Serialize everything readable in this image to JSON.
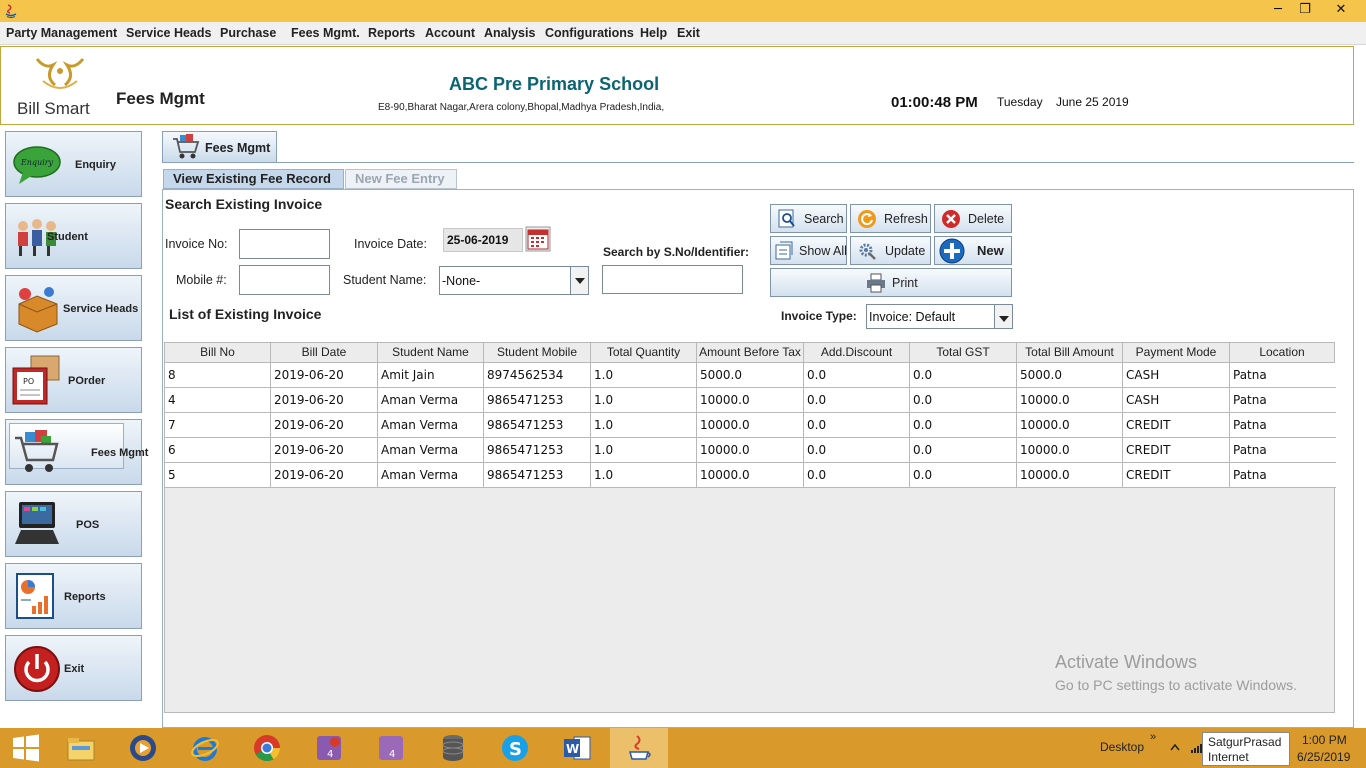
{
  "window": {
    "minimize": "─",
    "maximize": "❐",
    "close": "✕"
  },
  "menu": [
    "Party Management",
    "Service Heads",
    "Purchase",
    "Fees Mgmt.",
    "Reports",
    "Account",
    "Analysis",
    "Configurations",
    "Help",
    "Exit"
  ],
  "header": {
    "logo_text": "Bill Smart",
    "module_title": "Fees Mgmt",
    "school_name": "ABC Pre Primary School",
    "school_address": "E8-90,Bharat Nagar,Arera colony,Bhopal,Madhya Pradesh,India,",
    "time": "01:00:48 PM",
    "day": "Tuesday",
    "date": "June 25 2019"
  },
  "sidebar": {
    "items": [
      {
        "label": "Enquiry",
        "icon": "enquiry-bubble-icon"
      },
      {
        "label": "Student",
        "icon": "students-group-icon"
      },
      {
        "label": "Service Heads",
        "icon": "service-box-icon"
      },
      {
        "label": "POrder",
        "icon": "purchase-order-icon"
      },
      {
        "label": "Fees Mgmt",
        "icon": "shopping-cart-icon",
        "active": true
      },
      {
        "label": "POS",
        "icon": "pos-terminal-icon"
      },
      {
        "label": "Reports",
        "icon": "report-chart-icon"
      },
      {
        "label": "Exit",
        "icon": "power-icon"
      }
    ]
  },
  "main_tab": {
    "label": "Fees Mgmt"
  },
  "subtabs": {
    "active": "View Existing Fee Record",
    "inactive": "New Fee Entry"
  },
  "search": {
    "title": "Search Existing Invoice",
    "invoice_no_label": "Invoice No:",
    "invoice_no_value": "",
    "invoice_date_label": "Invoice Date:",
    "invoice_date_value": "25-06-2019",
    "mobile_label": "Mobile #:",
    "mobile_value": "",
    "student_name_label": "Student Name:",
    "student_name_value": "-None-",
    "sno_label": "Search by S.No/Identifier:",
    "sno_value": ""
  },
  "buttons": {
    "search": "Search",
    "refresh": "Refresh",
    "delete": "Delete",
    "show_all": "Show All",
    "update": "Update",
    "new": "New",
    "print": "Print"
  },
  "list": {
    "title": "List of Existing Invoice",
    "invoice_type_label": "Invoice Type:",
    "invoice_type_value": "Invoice: Default"
  },
  "table": {
    "columns": [
      "Bill No",
      "Bill Date",
      "Student Name",
      "Student Mobile",
      "Total Quantity",
      "Amount Before Tax",
      "Add.Discount",
      "Total GST",
      "Total Bill Amount",
      "Payment Mode",
      "Location"
    ],
    "rows": [
      [
        "8",
        "2019-06-20",
        "Amit Jain",
        "8974562534",
        "1.0",
        "5000.0",
        "0.0",
        "0.0",
        "5000.0",
        "CASH",
        "Patna"
      ],
      [
        "4",
        "2019-06-20",
        "Aman Verma",
        "9865471253",
        "1.0",
        "10000.0",
        "0.0",
        "0.0",
        "10000.0",
        "CASH",
        "Patna"
      ],
      [
        "7",
        "2019-06-20",
        "Aman Verma",
        "9865471253",
        "1.0",
        "10000.0",
        "0.0",
        "0.0",
        "10000.0",
        "CREDIT",
        "Patna"
      ],
      [
        "6",
        "2019-06-20",
        "Aman Verma",
        "9865471253",
        "1.0",
        "10000.0",
        "0.0",
        "0.0",
        "10000.0",
        "CREDIT",
        "Patna"
      ],
      [
        "5",
        "2019-06-20",
        "Aman Verma",
        "9865471253",
        "1.0",
        "10000.0",
        "0.0",
        "0.0",
        "10000.0",
        "CREDIT",
        "Patna"
      ]
    ]
  },
  "watermark": {
    "line1": "Activate Windows",
    "line2": "Go to PC settings to activate Windows."
  },
  "taskbar": {
    "apps": [
      "start-icon",
      "file-explorer-icon",
      "media-player-icon",
      "internet-explorer-icon",
      "chrome-icon",
      "photoshop-icon",
      "photoshop-icon",
      "database-icon",
      "skype-icon",
      "word-icon",
      "java-icon"
    ],
    "desktop_label": "Desktop",
    "chevron": "»",
    "tooltip_line1": "SatgurPrasad",
    "tooltip_line2": "Internet access",
    "time": "1:00 PM",
    "date": "6/25/2019"
  },
  "colors": {
    "title_bar": "#f4c44b",
    "taskbar": "#d99a2b",
    "school_name": "#0a6472",
    "accent_blue": "#c5d7eb"
  }
}
